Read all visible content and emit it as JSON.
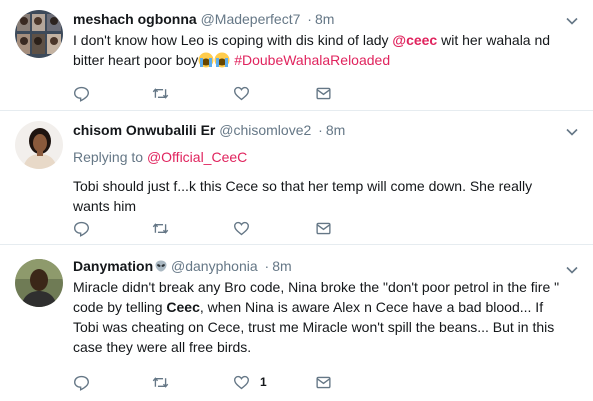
{
  "tweets": [
    {
      "fullname": "meshach ogbonna",
      "screen_name": "@Madeperfect7",
      "dot": "·",
      "time": "8m",
      "text_parts": [
        "I don't know how Leo is coping with dis kind of lady ",
        "@ceec",
        " wit her wahala nd bitter heart poor boy",
        "#DoubeWahalaReloaded"
      ],
      "reply_count": "",
      "retweet_count": "",
      "like_count": ""
    },
    {
      "fullname": "chisom Onwubalili Er",
      "screen_name": "@chisomlove2",
      "dot": "·",
      "time": "8m",
      "replying_to_label": "Replying to",
      "replying_to_handle": "@Official_CeeC",
      "text": "Tobi should just f...k this Cece so that her temp will come down. She really wants him",
      "reply_count": "",
      "retweet_count": "",
      "like_count": ""
    },
    {
      "fullname": "Danymation",
      "screen_name": "@danyphonia",
      "dot": "·",
      "time": "8m",
      "text_parts": [
        "Miracle didn't break any Bro code, Nina broke the \"don't poor petrol in the fire \" code by telling ",
        "Ceec",
        ", when Nina is aware Alex n Cece have a bad blood... If Tobi was cheating on Cece, trust me Miracle won't spill the beans... But in this case they were all free birds."
      ],
      "reply_count": "",
      "retweet_count": "",
      "like_count": "1"
    }
  ],
  "colors": {
    "link_mention": "#e0245e",
    "muted": "#657786",
    "text": "#14171a"
  },
  "icons": [
    "reply-icon",
    "retweet-icon",
    "like-icon",
    "dm-icon",
    "chevron-down-icon",
    "alien-emoji-icon",
    "crying-emoji-icon"
  ]
}
